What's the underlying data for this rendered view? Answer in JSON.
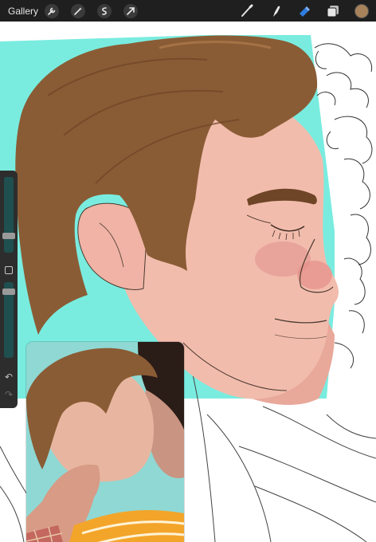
{
  "toolbar": {
    "gallery_label": "Gallery",
    "left_icons": [
      "wrench-icon",
      "magic-wand-icon",
      "selection-icon",
      "transform-arrow-icon"
    ],
    "right_icons": [
      "brush-icon",
      "smudge-icon",
      "eraser-icon",
      "layers-icon"
    ],
    "active_tool": "eraser",
    "current_color": "#a7825a",
    "active_color": "#2f7de1"
  },
  "sidebar": {
    "brush_size_level": 0.46,
    "opacity_level": 0.55,
    "icons": [
      "modify-square-icon",
      "undo-icon",
      "redo-icon"
    ]
  },
  "colors": {
    "background_teal": "#79ecdf",
    "hair": "#8a5c35",
    "skin": "#f2bcad",
    "shirt_yellow": "#f3a52a"
  }
}
